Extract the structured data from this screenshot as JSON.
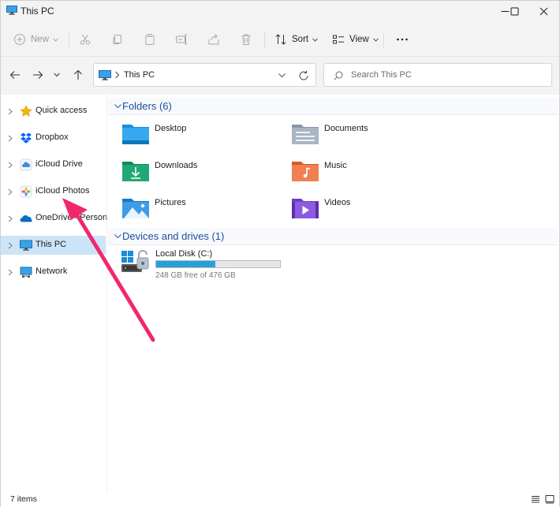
{
  "window": {
    "title": "This PC"
  },
  "toolbar": {
    "new_label": "New",
    "sort_label": "Sort",
    "view_label": "View"
  },
  "address": {
    "crumb": "This PC",
    "search_placeholder": "Search This PC"
  },
  "nav": {
    "items": [
      {
        "label": "Quick access",
        "icon": "star-icon"
      },
      {
        "label": "Dropbox",
        "icon": "dropbox-icon"
      },
      {
        "label": "iCloud Drive",
        "icon": "icloud-drive-icon"
      },
      {
        "label": "iCloud Photos",
        "icon": "icloud-photos-icon"
      },
      {
        "label": "OneDrive - Personal",
        "icon": "onedrive-icon"
      },
      {
        "label": "This PC",
        "icon": "computer-icon",
        "selected": true
      },
      {
        "label": "Network",
        "icon": "network-icon"
      }
    ]
  },
  "folders": {
    "header": "Folders (6)",
    "items": [
      {
        "label": "Desktop",
        "icon": "desktop-folder-icon"
      },
      {
        "label": "Documents",
        "icon": "documents-folder-icon"
      },
      {
        "label": "Downloads",
        "icon": "downloads-folder-icon"
      },
      {
        "label": "Music",
        "icon": "music-folder-icon"
      },
      {
        "label": "Pictures",
        "icon": "pictures-folder-icon"
      },
      {
        "label": "Videos",
        "icon": "videos-folder-icon"
      }
    ]
  },
  "drives": {
    "header": "Devices and drives (1)",
    "items": [
      {
        "label": "Local Disk (C:)",
        "free_text": "248 GB free of 476 GB",
        "used_fraction": 0.479
      }
    ]
  },
  "status": {
    "count": "7 items"
  },
  "colors": {
    "accent": "#0067c0",
    "selection": "#cce4f7",
    "annotation_arrow": "#f0286e",
    "drive_bar": "#26a0da"
  }
}
